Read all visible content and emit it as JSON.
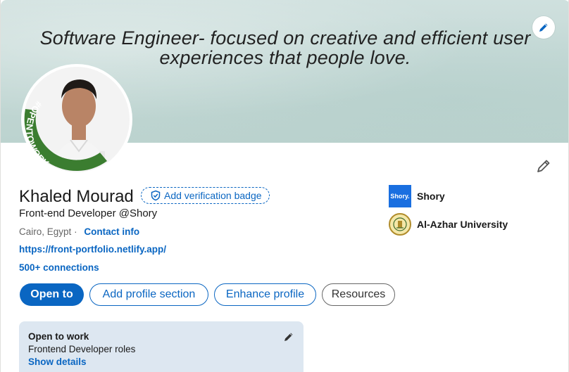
{
  "banner": {
    "text_line1": "Software Engineer- focused on creative and efficient user",
    "text_line2": "experiences that people love."
  },
  "profile": {
    "name": "Khaled Mourad",
    "verification_label": "Add verification badge",
    "headline": "Front-end Developer @Shory",
    "location": "Cairo, Egypt",
    "location_separator": "·",
    "contact_label": "Contact info",
    "website": "https://front-portfolio.netlify.app/",
    "connections": "500+ connections",
    "avatar_frame_text": "#OPENTOWORK"
  },
  "orgs": [
    {
      "logo_text": "Shory.",
      "name": "Shory"
    },
    {
      "logo_text": "",
      "name": "Al-Azhar University"
    }
  ],
  "actions": {
    "open_to": "Open to",
    "add_section": "Add profile section",
    "enhance": "Enhance profile",
    "resources": "Resources"
  },
  "open_to_work": {
    "title": "Open to work",
    "roles": "Frontend Developer roles",
    "details_link": "Show details"
  },
  "colors": {
    "accent": "#0a66c2",
    "otw_green": "#3b7d30",
    "otw_card_bg": "#dde7f1"
  },
  "icons": [
    "pencil-icon",
    "shield-check-icon"
  ]
}
